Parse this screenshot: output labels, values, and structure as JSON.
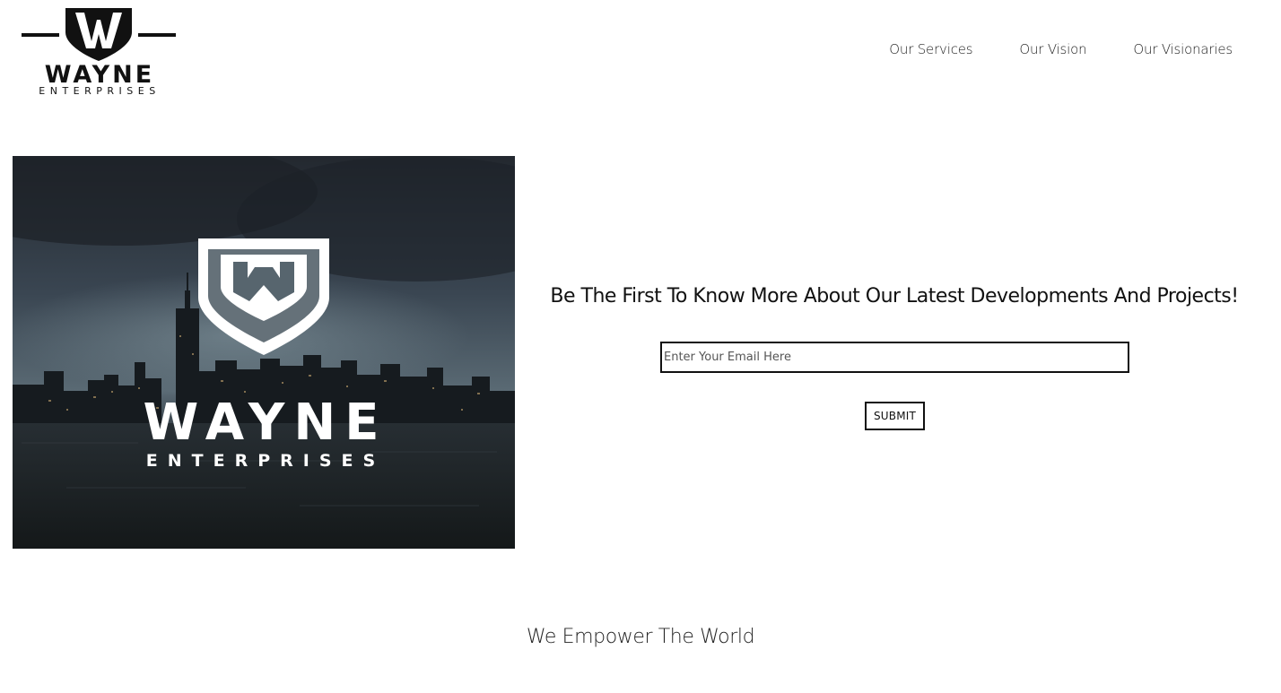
{
  "header": {
    "logo_wordmark": "WAYNE",
    "logo_subtitle": "ENTERPRISES",
    "nav": [
      {
        "label": "Our Services"
      },
      {
        "label": "Our Vision"
      },
      {
        "label": "Our Visionaries"
      }
    ]
  },
  "hero": {
    "image_wordmark": "WAYNE",
    "image_subtitle": "ENTERPRISES"
  },
  "signup": {
    "title": "Be The First To Know More About Our Latest Developments And Projects!",
    "email_placeholder": "Enter Your Email Here",
    "email_value": "",
    "submit_label": "SUBMIT"
  },
  "tagline": "We Empower The World"
}
